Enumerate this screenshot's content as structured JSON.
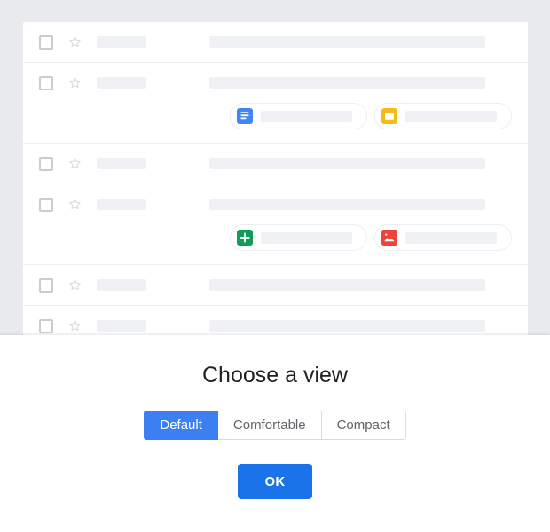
{
  "background_list": {
    "name": "email-list",
    "placeholder_rows": [
      {
        "id": "row-1",
        "has_attachments": false,
        "attachments": []
      },
      {
        "id": "row-2",
        "has_attachments": true,
        "attachments": [
          {
            "icon": "google-docs-icon",
            "color": "#4285f4",
            "type": "document"
          },
          {
            "icon": "google-slides-icon",
            "color": "#f5bb16",
            "type": "presentation"
          }
        ]
      },
      {
        "id": "row-3",
        "has_attachments": false,
        "attachments": []
      },
      {
        "id": "row-4",
        "has_attachments": true,
        "attachments": [
          {
            "icon": "google-sheets-icon",
            "color": "#0f9d58",
            "type": "spreadsheet"
          },
          {
            "icon": "image-attachment-icon",
            "color": "#e8453c",
            "type": "image"
          }
        ]
      },
      {
        "id": "row-5",
        "has_attachments": false,
        "attachments": []
      },
      {
        "id": "row-6",
        "has_attachments": false,
        "attachments": []
      }
    ],
    "row_icons": {
      "checkbox": "checkbox-icon",
      "star": "star-icon"
    }
  },
  "dialog": {
    "title": "Choose a view",
    "options": [
      {
        "label": "Default",
        "selected": true
      },
      {
        "label": "Comfortable",
        "selected": false
      },
      {
        "label": "Compact",
        "selected": false
      }
    ],
    "confirm_label": "OK"
  },
  "colors": {
    "page_background": "#e8eaed",
    "card_background": "#ffffff",
    "accent_blue": "#1a73e8",
    "selected_segment_blue": "#3b7ff2",
    "placeholder_gray": "#f0f1f4",
    "border_gray": "#dadce0",
    "text_primary": "#202124",
    "text_secondary": "#5f6368",
    "docs_blue": "#4285f4",
    "slides_yellow": "#f5bb16",
    "sheets_green": "#0f9d58",
    "image_red": "#e8453c"
  }
}
